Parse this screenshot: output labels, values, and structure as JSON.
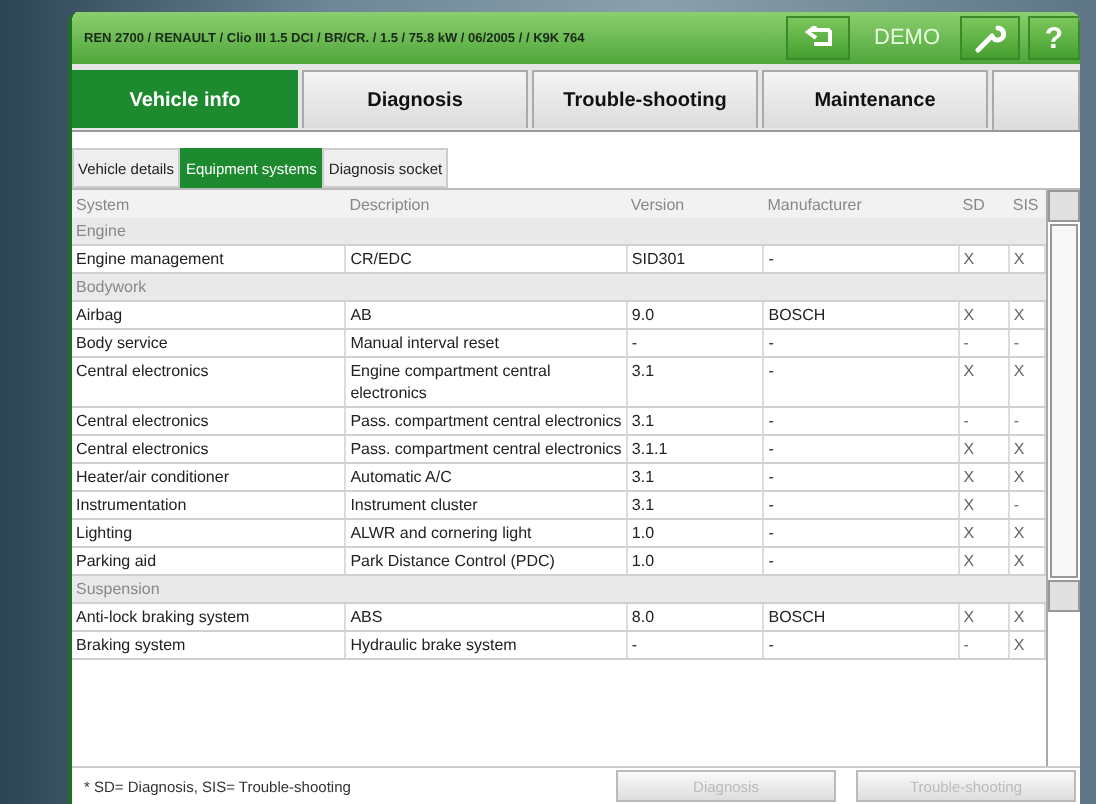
{
  "header": {
    "vehicle": "REN 2700 / RENAULT / Clio III 1.5 DCI / BR/CR. / 1.5 / 75.8 kW / 06/2005 / / K9K 764",
    "mode": "DEMO",
    "help": "?"
  },
  "tabs": [
    {
      "label": "Vehicle info",
      "selected": true
    },
    {
      "label": "Diagnosis",
      "selected": false
    },
    {
      "label": "Trouble-shooting",
      "selected": false
    },
    {
      "label": "Maintenance",
      "selected": false
    }
  ],
  "subtabs": [
    {
      "label": "Vehicle details",
      "selected": false
    },
    {
      "label": "Equipment systems",
      "selected": true
    },
    {
      "label": "Diagnosis socket",
      "selected": false
    }
  ],
  "table": {
    "columns": [
      "System",
      "Description",
      "Version",
      "Manufacturer",
      "SD",
      "SIS"
    ],
    "rows": [
      {
        "kind": "group",
        "system": "Engine"
      },
      {
        "kind": "item",
        "system": "Engine management",
        "description": "CR/EDC",
        "version": "SID301",
        "manufacturer": "-",
        "sd": "X",
        "sis": "X"
      },
      {
        "kind": "group",
        "system": "Bodywork"
      },
      {
        "kind": "item",
        "system": "Airbag",
        "description": "AB",
        "version": "9.0",
        "manufacturer": "BOSCH",
        "sd": "X",
        "sis": "X"
      },
      {
        "kind": "item",
        "system": "Body service",
        "description": "Manual interval reset",
        "version": "-",
        "manufacturer": "-",
        "sd": "-",
        "sis": "-"
      },
      {
        "kind": "item",
        "system": "Central electronics",
        "description": "Engine compartment central electronics",
        "version": "3.1",
        "manufacturer": "-",
        "sd": "X",
        "sis": "X"
      },
      {
        "kind": "item",
        "system": "Central electronics",
        "description": "Pass. compartment central electronics",
        "version": "3.1",
        "manufacturer": "-",
        "sd": "-",
        "sis": "-"
      },
      {
        "kind": "item",
        "system": "Central electronics",
        "description": "Pass. compartment central electronics",
        "version": "3.1.1",
        "manufacturer": "-",
        "sd": "X",
        "sis": "X"
      },
      {
        "kind": "item",
        "system": "Heater/air conditioner",
        "description": "Automatic A/C",
        "version": "3.1",
        "manufacturer": "-",
        "sd": "X",
        "sis": "X"
      },
      {
        "kind": "item",
        "system": "Instrumentation",
        "description": "Instrument cluster",
        "version": "3.1",
        "manufacturer": "-",
        "sd": "X",
        "sis": "-"
      },
      {
        "kind": "item",
        "system": "Lighting",
        "description": "ALWR and cornering light",
        "version": "1.0",
        "manufacturer": "-",
        "sd": "X",
        "sis": "X"
      },
      {
        "kind": "item",
        "system": "Parking aid",
        "description": "Park Distance Control (PDC)",
        "version": "1.0",
        "manufacturer": "-",
        "sd": "X",
        "sis": "X"
      },
      {
        "kind": "group",
        "system": "Suspension"
      },
      {
        "kind": "item",
        "system": "Anti-lock braking system",
        "description": "ABS",
        "version": "8.0",
        "manufacturer": "BOSCH",
        "sd": "X",
        "sis": "X"
      },
      {
        "kind": "item",
        "system": "Braking system",
        "description": "Hydraulic brake system",
        "version": "-",
        "manufacturer": "-",
        "sd": "-",
        "sis": "X"
      }
    ]
  },
  "footnote": "* SD= Diagnosis, SIS= Trouble-shooting",
  "buttons": [
    {
      "label": "Diagnosis",
      "disabled": true
    },
    {
      "label": "Trouble-shooting",
      "disabled": true
    }
  ]
}
